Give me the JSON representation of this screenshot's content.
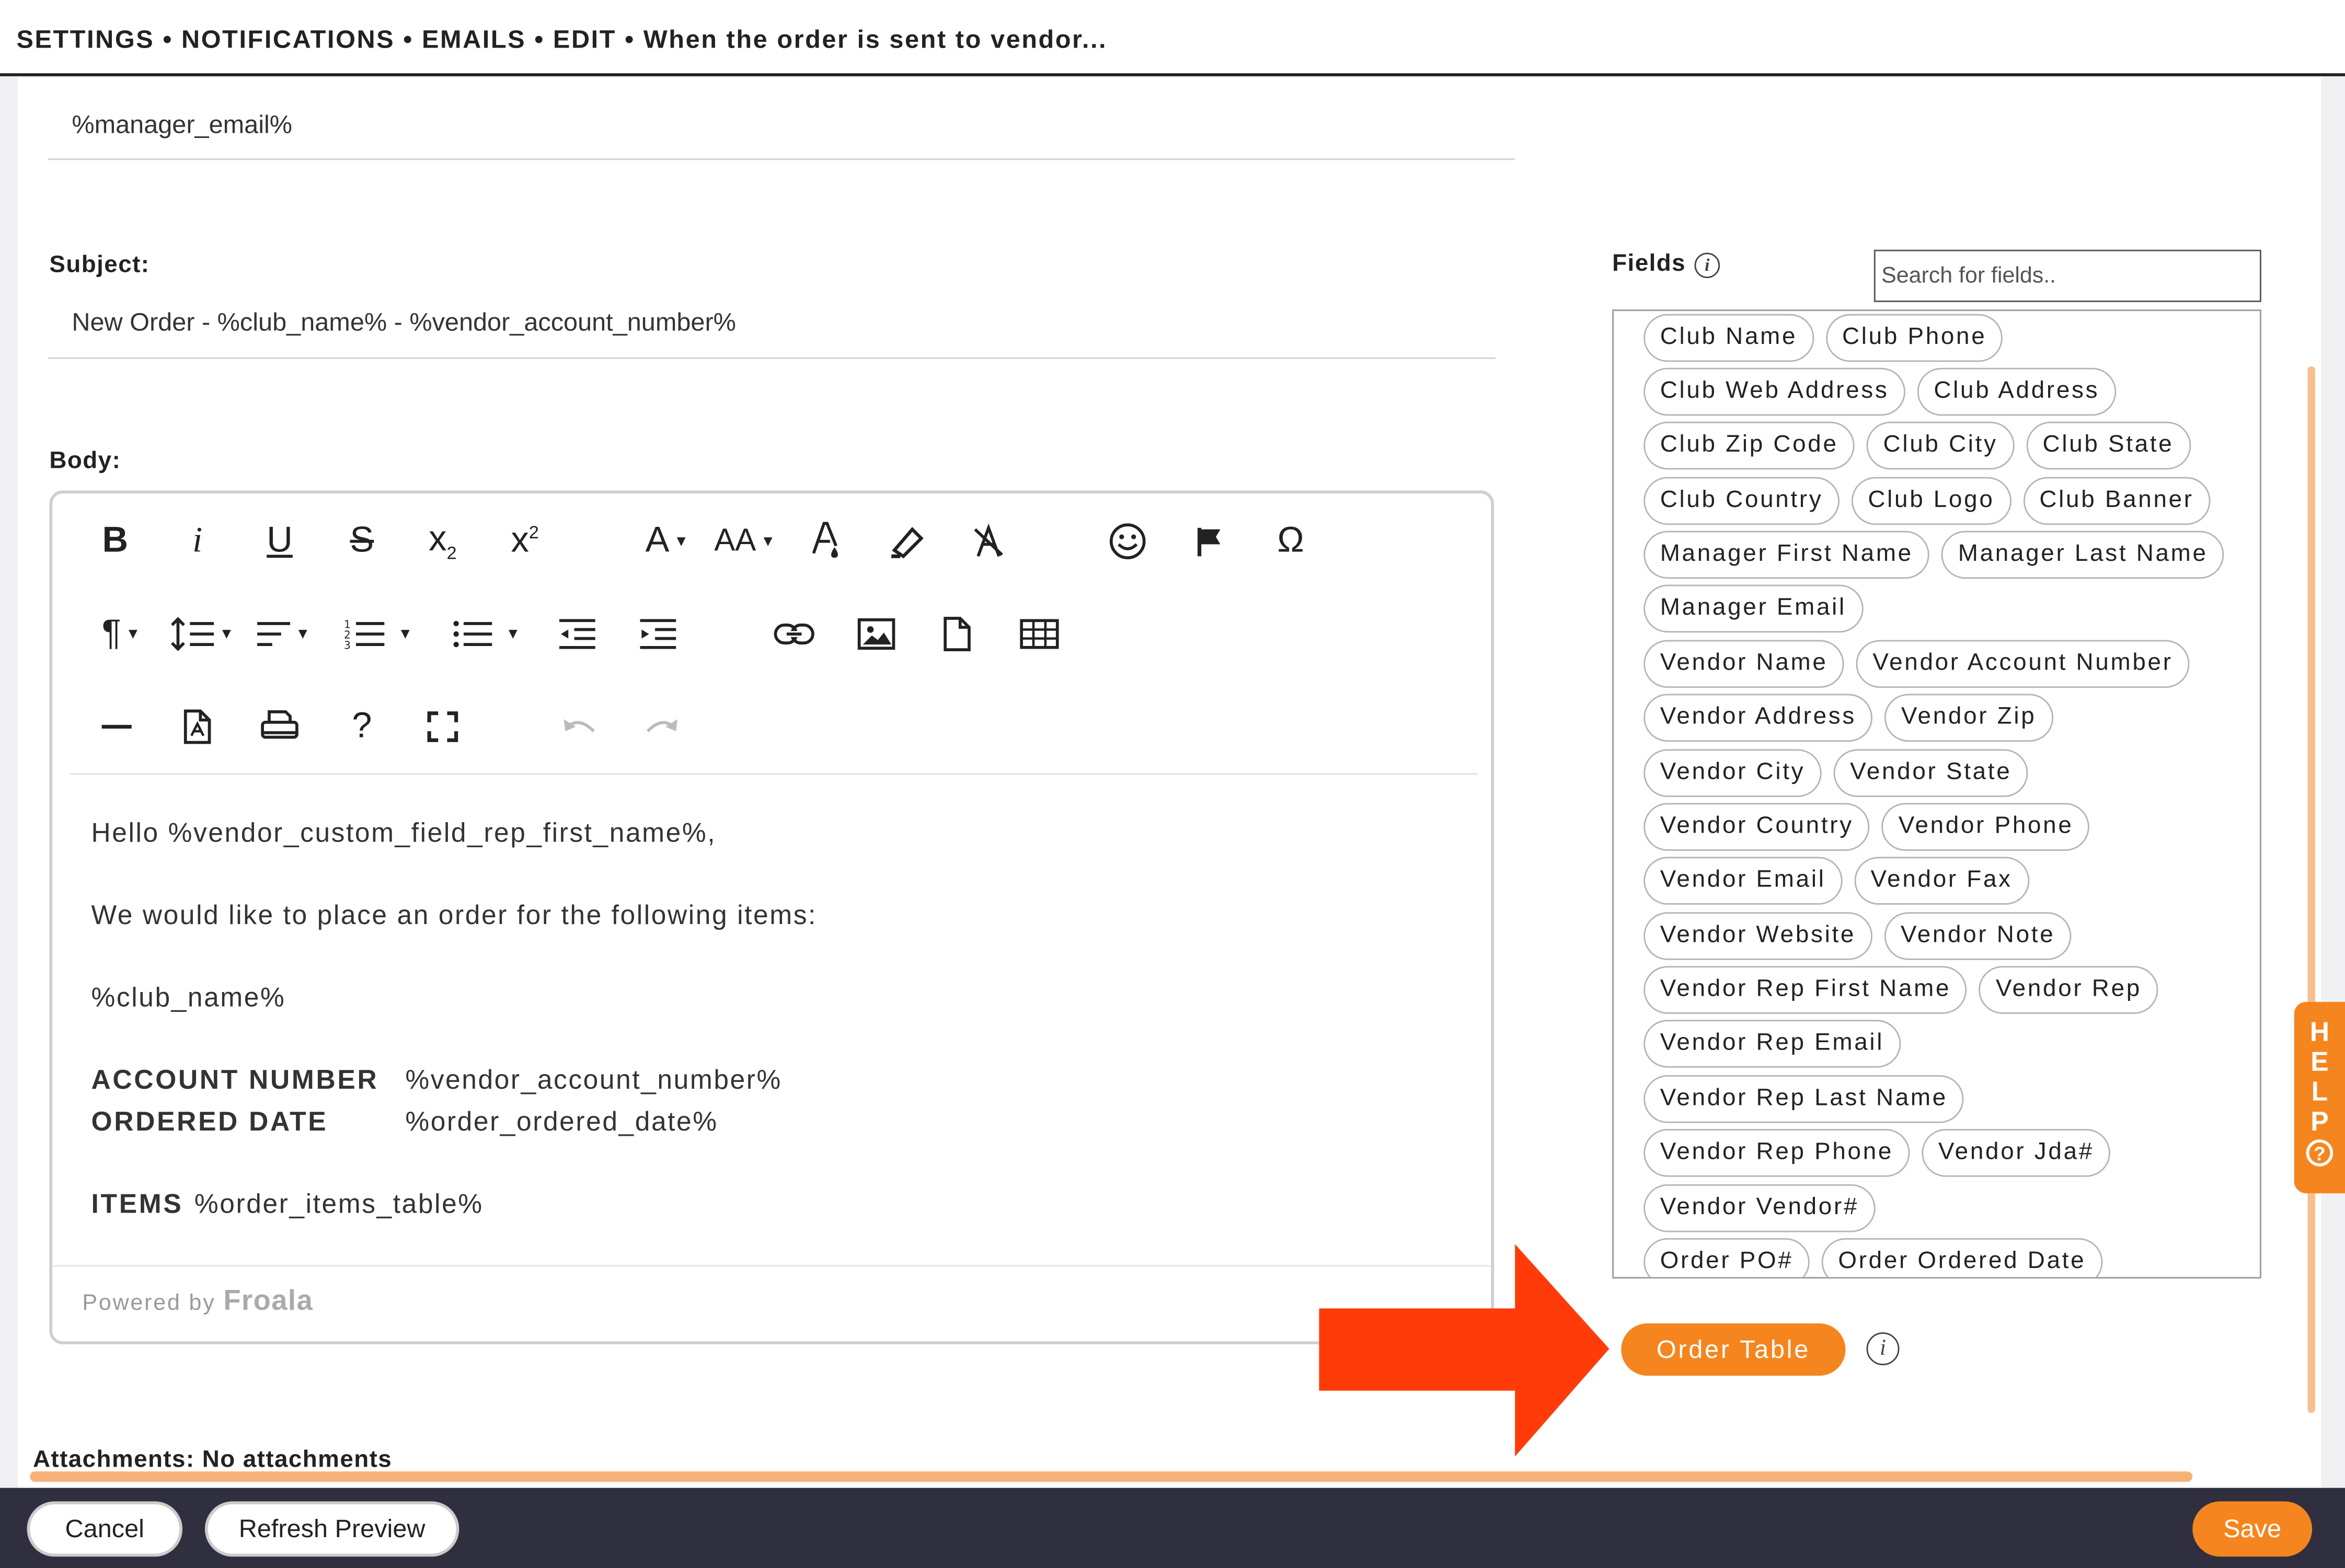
{
  "breadcrumb": "SETTINGS • NOTIFICATIONS • EMAILS • EDIT • When the order is sent to vendor...",
  "to_field": {
    "value": "%manager_email%"
  },
  "subject": {
    "label": "Subject:",
    "value": "New Order - %club_name% - %vendor_account_number%"
  },
  "body_section": {
    "label": "Body:"
  },
  "toolbar": {
    "bold": "B",
    "italic": "i",
    "underline": "U",
    "strikethrough": "S",
    "subscript": "x",
    "subscript_mark": "2",
    "superscript": "x",
    "superscript_mark": "2",
    "font_family": "A",
    "font_size": "AA",
    "special_chars": "Ω",
    "help": "?"
  },
  "editor_body": {
    "greeting": "Hello %vendor_custom_field_rep_first_name%,",
    "intro": "We would like to place an order for the following items:",
    "club_name": "%club_name%",
    "account_label": "ACCOUNT NUMBER",
    "account_value": "%vendor_account_number%",
    "ordered_label": "ORDERED DATE",
    "ordered_value": "%order_ordered_date%",
    "items_label": "ITEMS",
    "items_value": "%order_items_table%"
  },
  "powered_by": {
    "prefix": "Powered by",
    "brand": "Froala"
  },
  "fields_panel": {
    "title": "Fields",
    "info": "i",
    "search_placeholder": "Search for fields..",
    "rows": [
      [
        "Club Name",
        "Club Phone"
      ],
      [
        "Club Web Address",
        "Club Address"
      ],
      [
        "Club Zip Code",
        "Club City",
        "Club State"
      ],
      [
        "Club Country",
        "Club Logo",
        "Club Banner"
      ],
      [
        "Manager First Name",
        "Manager Last Name"
      ],
      [
        "Manager Email"
      ],
      [
        "Vendor Name",
        "Vendor Account Number"
      ],
      [
        "Vendor Address",
        "Vendor Zip"
      ],
      [
        "Vendor City",
        "Vendor State"
      ],
      [
        "Vendor Country",
        "Vendor Phone"
      ],
      [
        "Vendor Email",
        "Vendor Fax"
      ],
      [
        "Vendor Website",
        "Vendor Note"
      ],
      [
        "Vendor Rep First Name",
        "Vendor Rep"
      ],
      [
        "Vendor Rep Email"
      ],
      [
        "Vendor Rep Last Name"
      ],
      [
        "Vendor Rep Phone",
        "Vendor Jda#"
      ],
      [
        "Vendor Vendor#"
      ],
      [
        "Order PO#",
        "Order Ordered Date"
      ]
    ]
  },
  "order_table_button": "Order Table",
  "order_table_info": "i",
  "attachments": "Attachments: No attachments",
  "footer": {
    "cancel": "Cancel",
    "refresh": "Refresh Preview",
    "save": "Save"
  },
  "help_tab": {
    "letters": [
      "H",
      "E",
      "L",
      "P"
    ],
    "icon": "?"
  },
  "colors": {
    "accent": "#f5861f",
    "arrow": "#ff3b0a",
    "footer_bg": "#2f2f3f"
  }
}
